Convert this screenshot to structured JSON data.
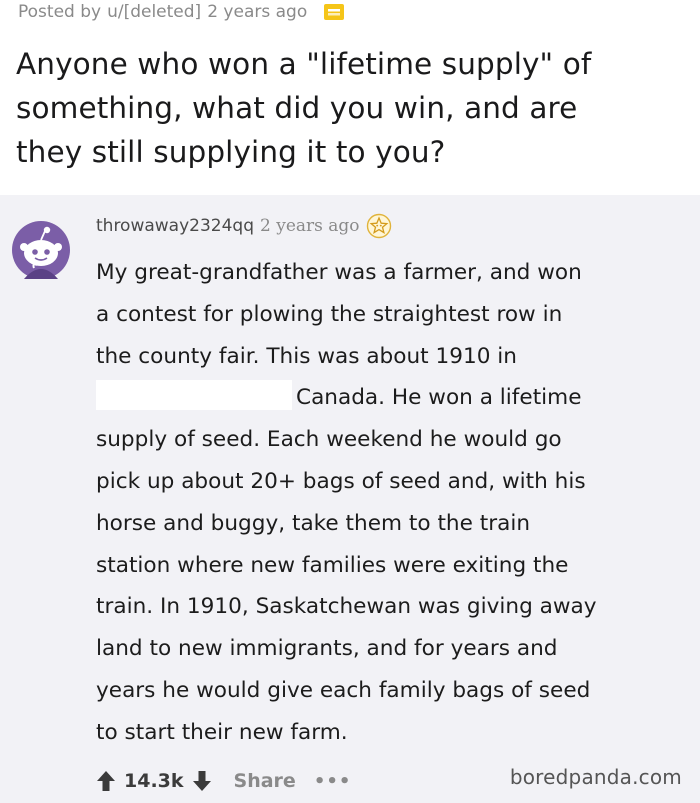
{
  "post": {
    "meta_prefix": "Posted by",
    "author": "u/[deleted]",
    "time_ago": "2 years ago",
    "award_icon": "gold-award-icon",
    "title_lines": [
      "Anyone who won a \"lifetime supply\" of",
      "something, what did you win, and are",
      "they still supplying it to you?"
    ]
  },
  "comment": {
    "avatar_icon": "snoo-avatar-icon",
    "username": "throwaway2324qq",
    "time_ago": "2 years ago",
    "badge_icon": "helpful-award-icon",
    "body_lines": [
      "My great-grandfather was a farmer, and won",
      "a contest for plowing the straightest row in",
      "the county fair. This was about 1910 in",
      "Canada. He won a lifetime",
      "supply of seed. Each weekend he would go",
      "pick up about 20+ bags of seed and, with his",
      "horse and buggy, take them to the train",
      "station where new families were exiting the",
      "train. In 1910, Saskatchewan was giving away",
      "land to new immigrants, and for years and",
      "years he would give each family bags of seed",
      "to start their new farm."
    ],
    "score": "14.3k",
    "share_label": "Share",
    "more_label": "•••"
  },
  "watermark": "boredpanda.com",
  "colors": {
    "background": "#f2f2f6",
    "header_background": "#ffffff",
    "award_gold": "#f5c518",
    "vote_arrow": "#3b3b3b",
    "avatar_purple": "#7b5ea7"
  }
}
